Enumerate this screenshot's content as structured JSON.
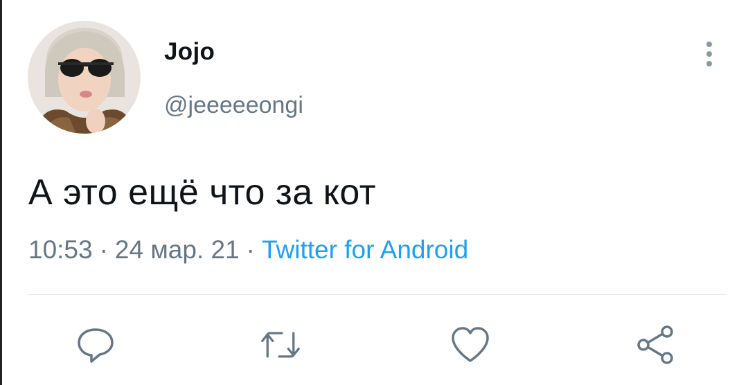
{
  "tweet": {
    "display_name": "Jojo",
    "handle": "@jeeeeeongi",
    "text": "А это ещё что за кот",
    "time": "10:53",
    "date": "24 мар. 21",
    "separator": "·",
    "source": "Twitter for Android"
  },
  "icons": {
    "more": "more-vertical-icon",
    "reply": "reply-icon",
    "retweet": "retweet-icon",
    "like": "heart-icon",
    "share": "share-icon"
  },
  "colors": {
    "text": "#0f1419",
    "secondary": "#657786",
    "link": "#1da1f2",
    "icon": "#657786"
  }
}
